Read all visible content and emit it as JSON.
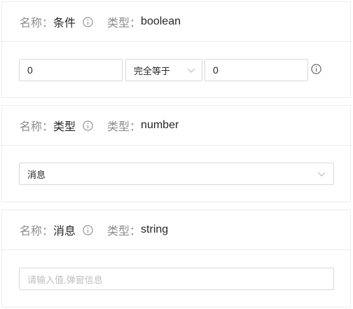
{
  "labels": {
    "name": "名称：",
    "type": "类型："
  },
  "cards": [
    {
      "name": "条件",
      "type": "boolean",
      "left_value": "0",
      "operator": "完全等于",
      "right_value": "0"
    },
    {
      "name": "类型",
      "type": "number",
      "selected": "消息"
    },
    {
      "name": "消息",
      "type": "string",
      "placeholder": "请输入值,弹窗信息"
    }
  ],
  "icons": {
    "info": "info-circle-icon",
    "chevron": "chevron-down-icon"
  },
  "colors": {
    "muted": "#8c8c8c",
    "border": "#d9d9d9",
    "divider": "#ececec"
  }
}
